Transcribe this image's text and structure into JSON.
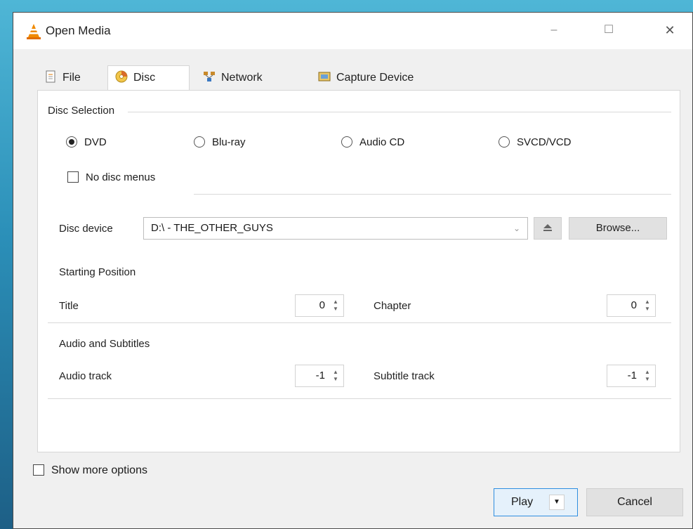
{
  "window": {
    "title": "Open Media",
    "controls": {
      "minimize": "–",
      "maximize": "☐",
      "close": "✕"
    }
  },
  "tabs": [
    {
      "label": "File",
      "icon": "file-icon",
      "active": false
    },
    {
      "label": "Disc",
      "icon": "disc-icon",
      "active": true
    },
    {
      "label": "Network",
      "icon": "network-icon",
      "active": false
    },
    {
      "label": "Capture Device",
      "icon": "capture-device-icon",
      "active": false
    }
  ],
  "disc_selection": {
    "group_label": "Disc Selection",
    "options": [
      {
        "label": "DVD",
        "selected": true
      },
      {
        "label": "Blu-ray",
        "selected": false
      },
      {
        "label": "Audio CD",
        "selected": false
      },
      {
        "label": "SVCD/VCD",
        "selected": false
      }
    ],
    "no_disc_menus": {
      "label": "No disc menus",
      "checked": false
    },
    "device_label": "Disc device",
    "device_value": "D:\\ - THE_OTHER_GUYS",
    "browse_label": "Browse..."
  },
  "starting_position": {
    "group_label": "Starting Position",
    "title_label": "Title",
    "title_value": "0",
    "chapter_label": "Chapter",
    "chapter_value": "0"
  },
  "audio_subtitles": {
    "group_label": "Audio and Subtitles",
    "audio_label": "Audio track",
    "audio_value": "-1",
    "subtitle_label": "Subtitle track",
    "subtitle_value": "-1"
  },
  "footer": {
    "show_more_label": "Show more options",
    "show_more_checked": false,
    "play_label": "Play",
    "cancel_label": "Cancel"
  },
  "colors": {
    "accent": "#2f8ee0",
    "vlc_orange": "#f08a00"
  }
}
